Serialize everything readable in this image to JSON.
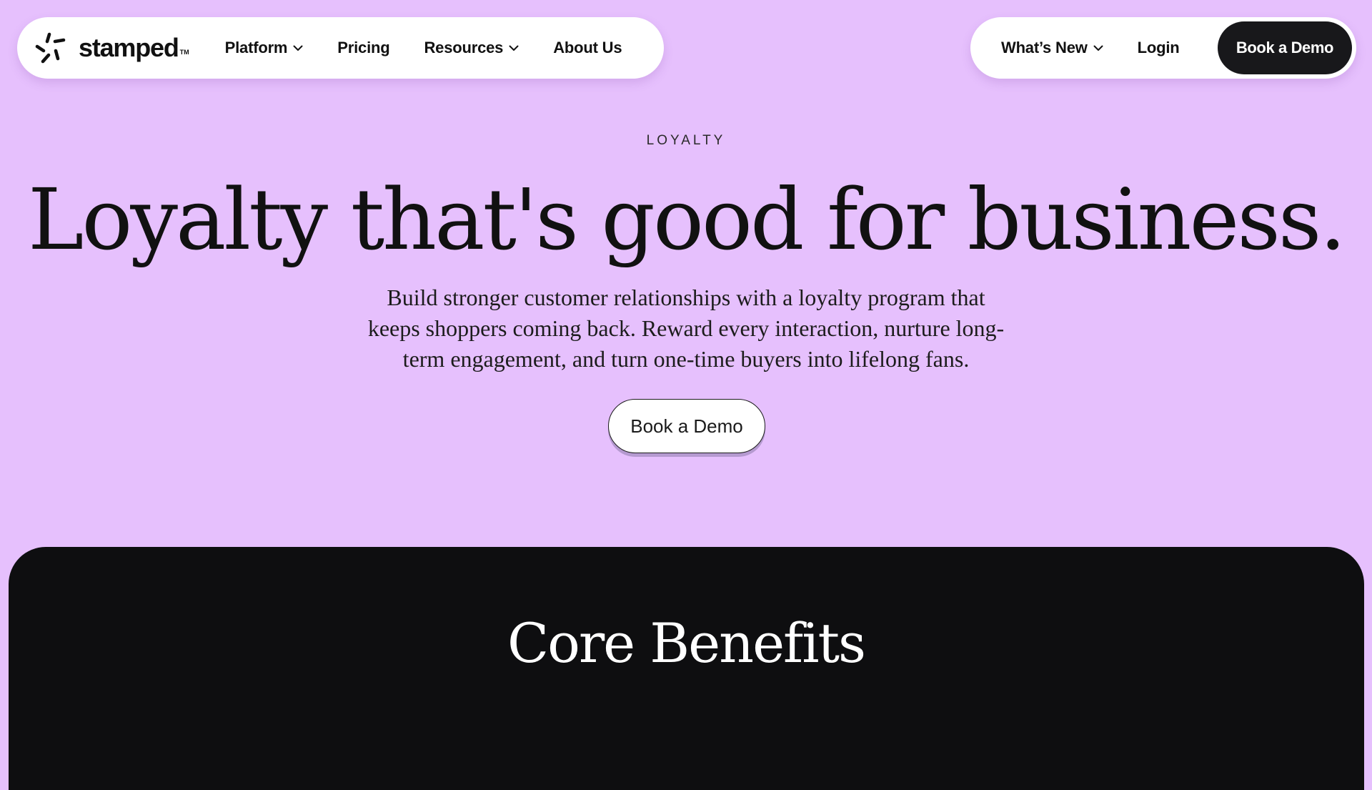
{
  "brand": {
    "name": "stamped",
    "tm": "TM",
    "logo_icon": "starburst-logo-icon"
  },
  "nav": {
    "left_items": [
      {
        "label": "Platform",
        "has_dropdown": true
      },
      {
        "label": "Pricing",
        "has_dropdown": false
      },
      {
        "label": "Resources",
        "has_dropdown": true
      },
      {
        "label": "About Us",
        "has_dropdown": false
      }
    ],
    "right_items": [
      {
        "label": "What’s New",
        "has_dropdown": true
      },
      {
        "label": "Login",
        "has_dropdown": false
      }
    ],
    "cta_label": "Book a Demo"
  },
  "hero": {
    "eyebrow": "LOYALTY",
    "title": "Loyalty that's good for business.",
    "subtitle_lines": [
      "Build stronger customer relationships with a loyalty program that",
      "keeps shoppers coming back. Reward every interaction, nurture long-",
      "term engagement, and turn one-time buyers into lifelong fans."
    ],
    "cta_label": "Book a Demo"
  },
  "benefits": {
    "title": "Core Benefits"
  },
  "colors": {
    "background": "#e6c0fd",
    "dark_section": "#0e0e10",
    "dark_button": "#18181b",
    "white": "#ffffff",
    "text": "#111111"
  }
}
